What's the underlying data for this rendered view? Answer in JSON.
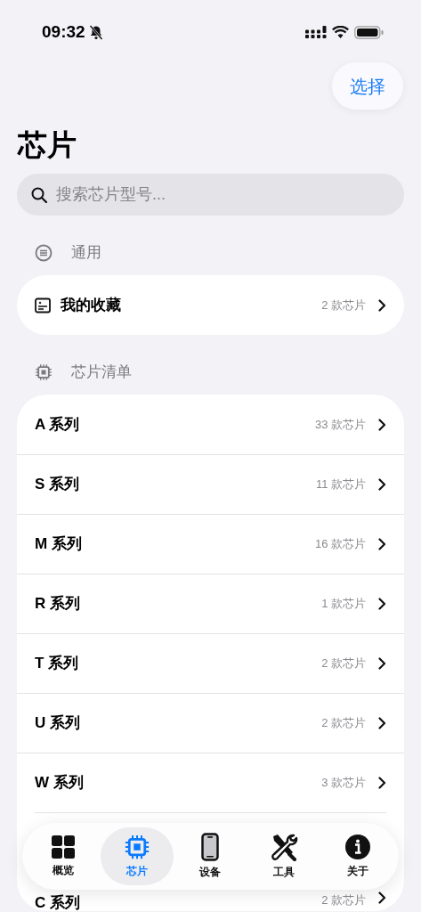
{
  "status_bar": {
    "time": "09:32"
  },
  "select_button": "选择",
  "title": "芯片",
  "search": {
    "placeholder": "搜索芯片型号..."
  },
  "sections": [
    {
      "kind": "general",
      "header": "通用",
      "rows": [
        {
          "kind": "favorites",
          "label": "我的收藏",
          "count": "2 款芯片"
        }
      ]
    },
    {
      "kind": "chips",
      "header": "芯片清单",
      "rows": [
        {
          "label": "A 系列",
          "count": "33 款芯片"
        },
        {
          "label": "S 系列",
          "count": "11 款芯片"
        },
        {
          "label": "M 系列",
          "count": "16 款芯片"
        },
        {
          "label": "R 系列",
          "count": "1 款芯片"
        },
        {
          "label": "T 系列",
          "count": "2 款芯片"
        },
        {
          "label": "U 系列",
          "count": "2 款芯片"
        },
        {
          "label": "W 系列",
          "count": "3 款芯片"
        },
        {
          "kind": "hidden"
        },
        {
          "label": "C 系列",
          "count": "2 款芯片"
        }
      ]
    }
  ],
  "tab_bar": [
    {
      "kind": "overview",
      "label": "概览",
      "selected": false
    },
    {
      "kind": "chip",
      "label": "芯片",
      "selected": true
    },
    {
      "kind": "device",
      "label": "设备",
      "selected": false
    },
    {
      "kind": "tools",
      "label": "工具",
      "selected": false
    },
    {
      "kind": "about",
      "label": "关于",
      "selected": false
    }
  ]
}
